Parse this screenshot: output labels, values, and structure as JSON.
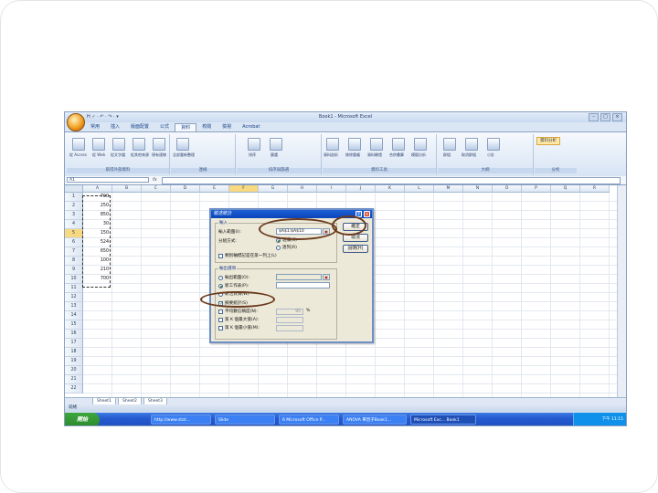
{
  "window": {
    "title": "Book1 - Microsoft Excel",
    "qat": "H ✓ · ↶ · ↷ · ▾",
    "controls": [
      "–",
      "□",
      "×"
    ]
  },
  "ribbon": {
    "tabs": [
      "常用",
      "插入",
      "版面配置",
      "公式",
      "資料",
      "校閱",
      "檢視",
      "Acrobat"
    ],
    "active_tab": "資料",
    "groups": [
      {
        "label": "取得外部資料",
        "buttons": [
          "從 Access",
          "從 Web",
          "從文字檔",
          "從其他來源",
          "現有連線"
        ]
      },
      {
        "label": "連線",
        "buttons": [
          "全部重新整理"
        ]
      },
      {
        "label": "排序與篩選",
        "buttons": [
          "排序",
          "篩選"
        ]
      },
      {
        "label": "資料工具",
        "buttons": [
          "資料剖析",
          "移除重複",
          "資料驗證",
          "合併彙算",
          "模擬分析"
        ]
      },
      {
        "label": "大綱",
        "buttons": [
          "群組",
          "取消群組",
          "小計"
        ]
      },
      {
        "label": "分析",
        "buttons": []
      }
    ],
    "analysis_button": "資料分析"
  },
  "formula_bar": {
    "name_box": "A1",
    "fx": "fx",
    "value": ""
  },
  "sheet": {
    "columns": [
      "A",
      "B",
      "C",
      "D",
      "E",
      "F",
      "G",
      "H",
      "I",
      "J",
      "K",
      "L",
      "M",
      "N",
      "O",
      "P",
      "Q",
      "R"
    ],
    "rows": [
      "1",
      "2",
      "3",
      "4",
      "5",
      "6",
      "7",
      "8",
      "9",
      "10",
      "11",
      "12",
      "13",
      "14",
      "15",
      "16",
      "17",
      "18",
      "19",
      "20",
      "21",
      "22"
    ],
    "a_values": [
      "700",
      "250",
      "850",
      "30",
      "150",
      "524",
      "650",
      "100",
      "210",
      "700"
    ],
    "tabs": [
      "Sheet1",
      "Sheet2",
      "Sheet3"
    ],
    "status": "就緒"
  },
  "dialog": {
    "title": "敘述統計",
    "input_group": "輸入",
    "input_range_label": "輸入範圍(I):",
    "input_range_value": "$A$1:$A$10",
    "grouped_by_label": "分組方式:",
    "grouped_by_options": [
      "逐欄(C)",
      "逐列(R)"
    ],
    "labels_first_row": "類別軸標記是在第一列上(L)",
    "output_group": "輸出選項",
    "output_range": "輸出範圍(O):",
    "new_sheet": "新工作表(P):",
    "new_workbook": "新活頁簿(W)",
    "summary_stats": "摘要統計(S)",
    "confidence_level": "平均數信賴度(N):",
    "confidence_value": "95",
    "confidence_unit": "%",
    "kth_largest": "第 K 個最大值(A):",
    "kth_smallest": "第 K 個最小值(M):",
    "buttons": [
      "確定",
      "取消",
      "說明(H)"
    ],
    "help_icon": "?",
    "close_icon": "×"
  },
  "taskbar": {
    "start": "開始",
    "tasks": [
      "http://www.stat...",
      "Slide",
      "6 Microsoft Office P...",
      "ANOVA 單因子Book1...",
      "Microsoft Exc... Book1"
    ],
    "clock": "下午 11:15"
  },
  "colors": {
    "annotation_oval": "#6b3a1e",
    "ribbon_bg": "#dbe6f4",
    "dialog_bg": "#ece9d8",
    "taskbar": "#245ad0"
  }
}
